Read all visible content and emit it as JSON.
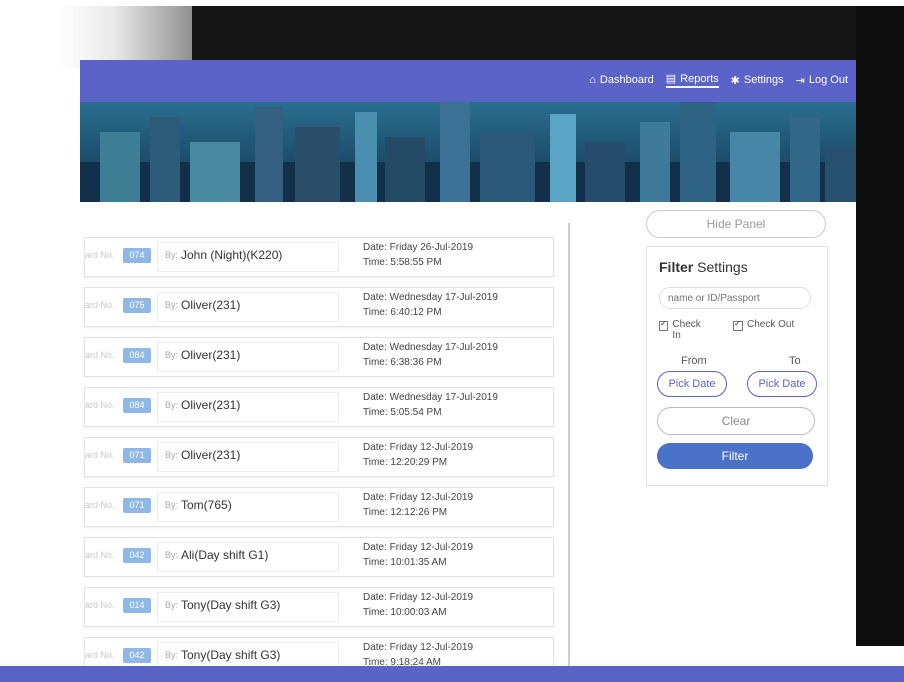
{
  "navbar": {
    "links": [
      {
        "label": "Dashboard",
        "icon": "home-icon"
      },
      {
        "label": "Reports",
        "icon": "file-icon",
        "active": true
      },
      {
        "label": "Settings",
        "icon": "gear-icon"
      },
      {
        "label": "Log Out",
        "icon": "logout-icon"
      }
    ]
  },
  "records": [
    {
      "badge": "074",
      "by": "John (Night)(K220)",
      "date": "Date: Friday 26-Jul-2019",
      "time": "Time: 5:58:55 PM"
    },
    {
      "badge": "075",
      "by": "Oliver(231)",
      "date": "Date: Wednesday 17-Jul-2019",
      "time": "Time: 6:40:12 PM"
    },
    {
      "badge": "084",
      "by": "Oliver(231)",
      "date": "Date: Wednesday 17-Jul-2019",
      "time": "Time: 6:38:36 PM"
    },
    {
      "badge": "084",
      "by": "Oliver(231)",
      "date": "Date: Wednesday 17-Jul-2019",
      "time": "Time: 5:05:54 PM"
    },
    {
      "badge": "071",
      "by": "Oliver(231)",
      "date": "Date: Friday 12-Jul-2019",
      "time": "Time: 12:20:29 PM"
    },
    {
      "badge": "071",
      "by": "Tom(765)",
      "date": "Date: Friday 12-Jul-2019",
      "time": "Time: 12:12:26 PM"
    },
    {
      "badge": "042",
      "by": "Ali(Day shift G1)",
      "date": "Date: Friday 12-Jul-2019",
      "time": "Time: 10:01:35 AM"
    },
    {
      "badge": "014",
      "by": "Tony(Day shift G3)",
      "date": "Date: Friday 12-Jul-2019",
      "time": "Time: 10:00:03 AM"
    },
    {
      "badge": "042",
      "by": "Tony(Day shift G3)",
      "date": "Date: Friday 12-Jul-2019",
      "time": "Time: 9:18:24 AM"
    }
  ],
  "record_labels": {
    "no": "ard No.",
    "by": "By:"
  },
  "filter": {
    "hide_panel": "Hide Panel",
    "title_bold": "Filter",
    "title_rest": "Settings",
    "search_placeholder": "name or ID/Passport",
    "check_in": "Check In",
    "check_out": "Check Out",
    "from": "From",
    "to": "To",
    "pick_from": "Pick Date",
    "pick_to": "Pick Date",
    "clear": "Clear",
    "filter": "Filter"
  },
  "colors": {
    "nav": "#5b63c8",
    "badge": "#8fb8e6",
    "filter_button": "#4a72c9"
  }
}
